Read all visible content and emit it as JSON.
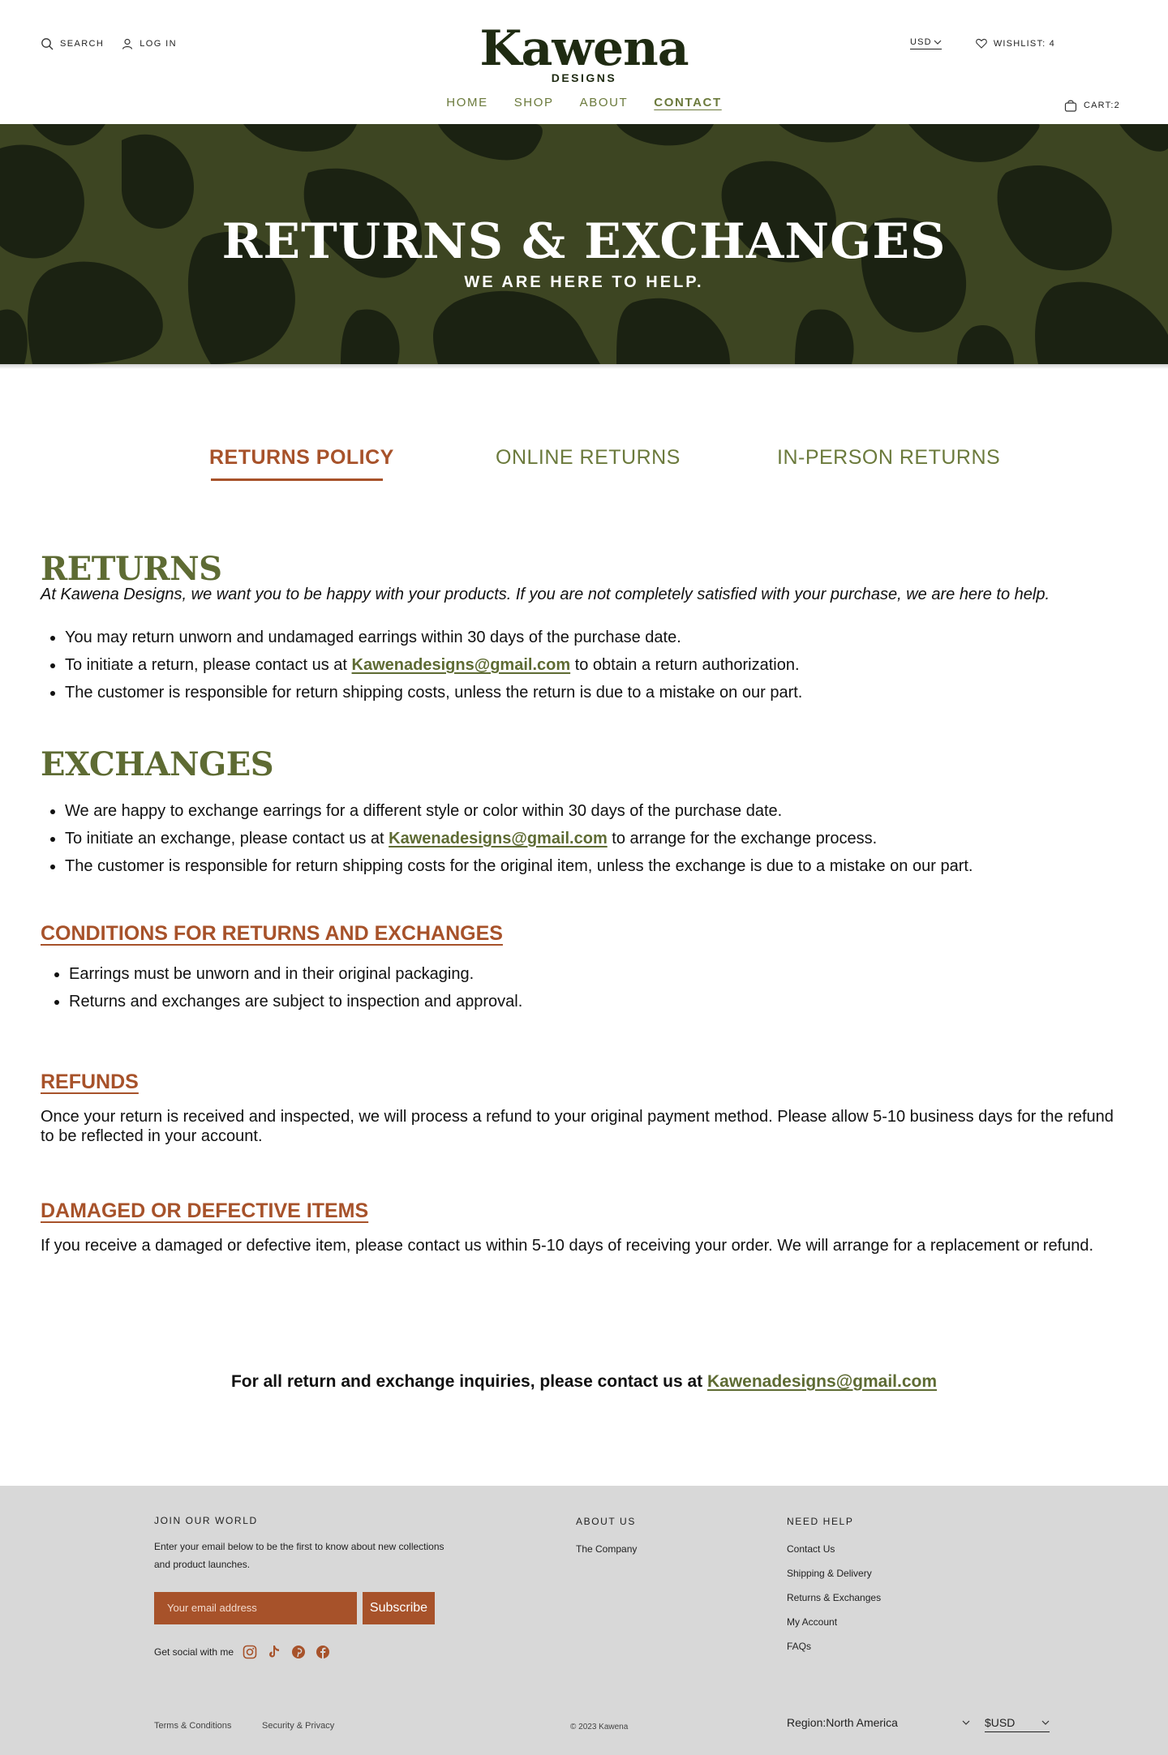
{
  "header": {
    "search": "SEARCH",
    "login": "LOG IN",
    "logo_word": "Kawena",
    "logo_sub": "DESIGNS",
    "currency": "USD",
    "wishlist": "WISHLIST: 4",
    "cart": "CART:2",
    "nav": [
      "HOME",
      "SHOP",
      "ABOUT",
      "CONTACT"
    ]
  },
  "hero": {
    "title": "RETURNS & EXCHANGES",
    "subtitle": "WE ARE HERE TO HELP."
  },
  "tabs": [
    "RETURNS POLICY",
    "ONLINE RETURNS",
    "IN-PERSON RETURNS"
  ],
  "email": "Kawenadesigns@gmail.com",
  "returns": {
    "heading": "RETURNS",
    "intro": "At Kawena Designs, we want you to be happy with your products.  If you are not completely satisfied with your purchase, we are here to help.",
    "b1": "You may return unworn and undamaged earrings within 30 days of the purchase date.",
    "b2_pre": "To initiate a return, please contact us at ",
    "b2_post": " to obtain a return authorization.",
    "b3": "The customer is responsible for return shipping costs, unless the return is due to a mistake on our part."
  },
  "exchanges": {
    "heading": "EXCHANGES",
    "b1": " We are happy to exchange earrings for a different style or color within 30 days of the purchase date.",
    "b2_pre": "To initiate an exchange, please contact us at ",
    "b2_post": " to arrange for the exchange process.",
    "b3": "The customer is responsible for return shipping costs for the original item, unless the exchange is due to a mistake on our part."
  },
  "conditions": {
    "heading": "CONDITIONS FOR RETURNS AND EXCHANGES",
    "b1": "Earrings must be unworn and in their original packaging.",
    "b2": "Returns and exchanges are subject to inspection and approval."
  },
  "refunds": {
    "heading": "REFUNDS",
    "text": "Once your return is received and inspected, we will process a refund to your original payment method. Please allow 5-10 business days for the refund to be reflected in your account."
  },
  "damaged": {
    "heading": "DAMAGED OR DEFECTIVE ITEMS",
    "text": "If you receive a damaged or defective item, please contact us within 5-10 days of receiving your order. We will arrange for a replacement or refund."
  },
  "contact_line": "For all return and exchange inquiries, please contact us at ",
  "footer": {
    "join_title": "JOIN OUR WORLD",
    "join_text": "Enter your email below to be the first to know about new collections and product launches.",
    "email_placeholder": "Your email address",
    "subscribe": "Subscribe",
    "social": "Get social with me",
    "about_title": "ABOUT US",
    "about_links": [
      "The Company"
    ],
    "help_title": "NEED HELP",
    "help_links": [
      "Contact Us",
      "Shipping & Delivery",
      "Returns & Exchanges",
      "My Account",
      "FAQs"
    ],
    "terms": "Terms & Conditions",
    "security": "Security & Privacy",
    "copyright": "© 2023 Kawena",
    "region": "Region:North America",
    "currency": "$USD"
  },
  "colors": {
    "olive": "#5e6b33",
    "rust": "#a7522a",
    "hero_bg": "#3d4522",
    "hero_shape": "#1b2212",
    "footer_bg": "#d8d8d8"
  }
}
